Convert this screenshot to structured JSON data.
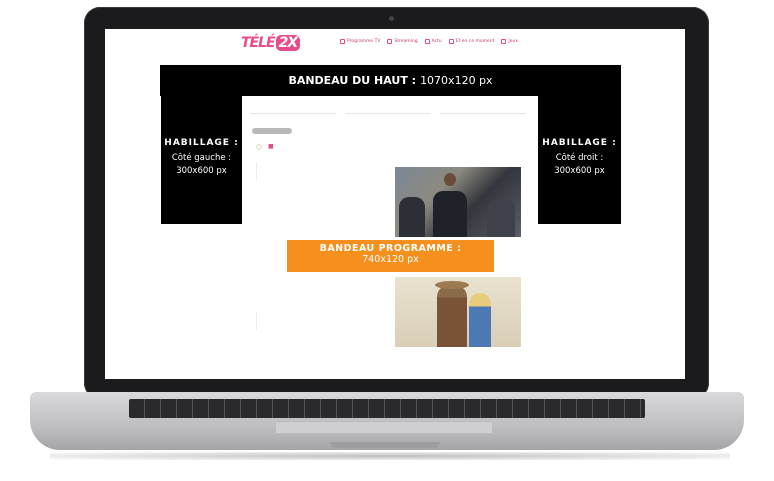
{
  "site": {
    "logo_left": "TÉLÉ",
    "logo_right": "2X",
    "nav": [
      {
        "label": "Programme TV"
      },
      {
        "label": "Streaming"
      },
      {
        "label": "Actu"
      },
      {
        "label": "Et en ce moment"
      },
      {
        "label": "Jeux"
      }
    ]
  },
  "ads": {
    "top_banner": {
      "title": "BANDEAU DU HAUT :",
      "size": "1070x120 px"
    },
    "left_skin": {
      "title": "HABILLAGE :",
      "side": "Côté gauche :",
      "size": "300x600 px"
    },
    "right_skin": {
      "title": "HABILLAGE :",
      "side": "Côté droit :",
      "size": "300x600 px"
    },
    "program_banner": {
      "title": "BANDEAU PROGRAMME :",
      "size": "740x120 px"
    }
  },
  "colors": {
    "brand": "#e64d8a",
    "ad_black": "#000000",
    "ad_orange": "#f5901e"
  }
}
